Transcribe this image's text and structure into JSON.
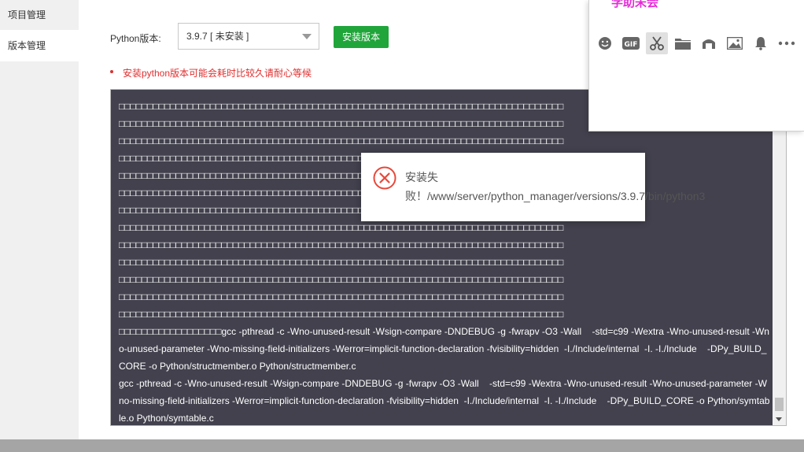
{
  "sidebar": {
    "items": [
      {
        "label": "项目管理",
        "active": false
      },
      {
        "label": "版本管理",
        "active": true
      }
    ]
  },
  "version_panel": {
    "label": "Python版本:",
    "selected": "3.9.7 [ 未安装 ]",
    "install_button": "安装版本",
    "warning": "安装python版本可能会耗时比较久请耐心等候"
  },
  "log": {
    "garbled_lines": [
      "□□□□□□□□□□□□□□□□□□□□□□□□□□□□□□□□□□□□□□□□□□□□□□□□□□□□□□□□□□□□□□□□□□□□□□□□□□□□□□",
      "□□□□□□□□□□□□□□□□□□□□□□□□□□□□□□□□□□□□□□□□□□□□□□□□□□□□□□□□□□□□□□□□□□□□□□□□□□□□□□",
      "□□□□□□□□□□□□□□□□□□□□□□□□□□□□□□□□□□□□□□□□□□□□□□□□□□□□□□□□□□□□□□□□□□□□□□□□□□□□□□",
      "□□□□□□□□□□□□□□□□□□□□□□□□□□□□□□□□□□□□□□□□□□□□□□□□□□□□□□□□□□□□□□□□□□□□□□□□□□□□□□",
      "□□□□□□□□□□□□□□□□□□□□□□□□□□□□□□□□□□□□□□□□□□□□□□□□□□□□□□□□□□□□□□□□□□□□□□□□□□□□□□",
      "□□□□□□□□□□□□□□□□□□□□□□□□□□□□□□□□□□□□□□□□□□□□□□□□□□□□□□□□□□□□□□□□□□□□□□□□□□□□□□",
      "□□□□□□□□□□□□□□□□□□□□□□□□□□□□□□□□□□□□□□□□□□□□□□□□□□□□□□□□□□□□□□□□□□□□□□□□□□□□□□",
      "□□□□□□□□□□□□□□□□□□□□□□□□□□□□□□□□□□□□□□□□□□□□□□□□□□□□□□□□□□□□□□□□□□□□□□□□□□□□□□",
      "□□□□□□□□□□□□□□□□□□□□□□□□□□□□□□□□□□□□□□□□□□□□□□□□□□□□□□□□□□□□□□□□□□□□□□□□□□□□□□",
      "□□□□□□□□□□□□□□□□□□□□□□□□□□□□□□□□□□□□□□□□□□□□□□□□□□□□□□□□□□□□□□□□□□□□□□□□□□□□□□",
      "□□□□□□□□□□□□□□□□□□□□□□□□□□□□□□□□□□□□□□□□□□□□□□□□□□□□□□□□□□□□□□□□□□□□□□□□□□□□□□",
      "□□□□□□□□□□□□□□□□□□□□□□□□□□□□□□□□□□□□□□□□□□□□□□□□□□□□□□□□□□□□□□□□□□□□□□□□□□□□□□",
      "□□□□□□□□□□□□□□□□□□□□□□□□□□□□□□□□□□□□□□□□□□□□□□□□□□□□□□□□□□□□□□□□□□□□□□□□□□□□□□"
    ],
    "text": "□□□□□□□□□□□□□□□□□□gcc -pthread -c -Wno-unused-result -Wsign-compare -DNDEBUG -g -fwrapv -O3 -Wall    -std=c99 -Wextra -Wno-unused-result -Wno-unused-parameter -Wno-missing-field-initializers -Werror=implicit-function-declaration -fvisibility=hidden  -I./Include/internal  -I. -I./Include    -DPy_BUILD_CORE -o Python/structmember.o Python/structmember.c\ngcc -pthread -c -Wno-unused-result -Wsign-compare -DNDEBUG -g -fwrapv -O3 -Wall    -std=c99 -Wextra -Wno-unused-result -Wno-unused-parameter -Wno-missing-field-initializers -Werror=implicit-function-declaration -fvisibility=hidden  -I./Include/internal  -I. -I./Include    -DPy_BUILD_CORE -o Python/symtable.o Python/symtable.c"
  },
  "toast": {
    "icon": "error-circle-icon",
    "message": "安装失败！/www/server/python_manager/versions/3.9.7/bin/python3"
  },
  "chat_panel": {
    "title": "学助未会",
    "toolbar": [
      "emoji-icon",
      "gif-icon",
      "scissors-icon",
      "folder-icon",
      "music-icon",
      "image-icon",
      "bell-icon",
      "more-icon"
    ]
  },
  "colors": {
    "accent_green": "#20a53a",
    "warning_red": "#e02f2f",
    "log_bg": "#42414d",
    "chat_title": "#e52bd6",
    "error_red": "#e8483a"
  }
}
